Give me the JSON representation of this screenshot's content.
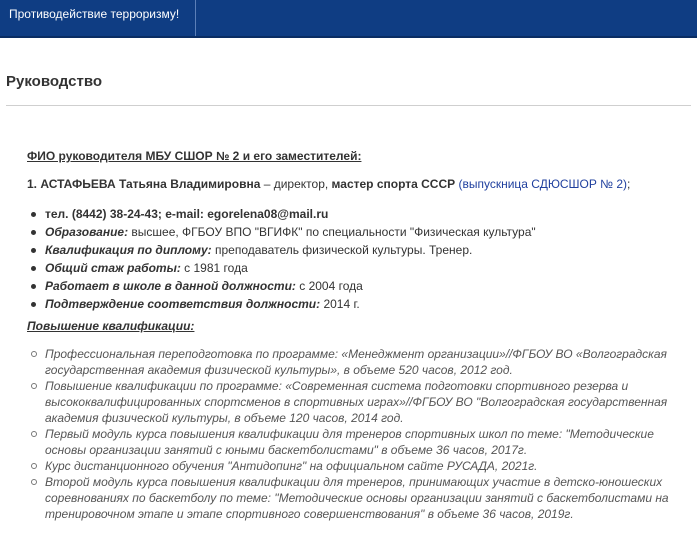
{
  "nav": {
    "item_label": "Противодействие терроризму!"
  },
  "page": {
    "title": "Руководство"
  },
  "section": {
    "heading": "ФИО руководителя МБУ СШОР № 2 и его заместителей:"
  },
  "person": {
    "number": "1.",
    "name": "АСТАФЬЕВА Татьяна Владимировна",
    "dash": " – ",
    "role": "директор, ",
    "title": "мастер спорта СССР",
    "alumna": "(выпускница СДЮСШОР № 2)",
    "end": ";"
  },
  "facts": [
    {
      "label": "тел. (8442) 38-24-43; e-mail: egorelena08@mail.ru",
      "value": ""
    },
    {
      "label": "Образование:",
      "value": " высшее, ФГБОУ ВПО \"ВГИФК\" по специальности \"Физическая культура\""
    },
    {
      "label": "Квалификация по диплому:",
      "value": " преподаватель физической культуры. Тренер."
    },
    {
      "label": "Общий стаж работы:",
      "value": " с 1981 года"
    },
    {
      "label": "Работает в школе в данной должности:",
      "value": " с 2004 года"
    },
    {
      "label": "Подтверждение соответствия должности:",
      "value": " 2014 г."
    }
  ],
  "qualification": {
    "heading": "Повышение квалификации:",
    "items": [
      "Профессиональная переподготовка по программе: «Менеджмент организации»//ФГБОУ ВО «Волгоградская государственная академия физической культуры», в объеме 520 часов, 2012 год.",
      "Повышение квалификации по программе: «Современная система подготовки спортивного резерва и высококвалифицированных спортсменов в спортивных играх»//ФГБОУ ВО \"Волгоградская государственная академия физической культуры, в объеме 120 часов, 2014 год.",
      "Первый модуль курса повышения квалификации для тренеров спортивных школ по теме: \"Методические основы организации занятий с юными баскетболистами\" в объеме 36 часов, 2017г.",
      "Курс дистанционного обучения \"Антидопинг\" на официальном сайте РУСАДА, 2021г.",
      "Второй модуль курса повышения квалификации для тренеров, принимающих участие в детско-юношеских соревнованиях по баскетболу по теме: \"Методические основы организации занятий с баскетболистами на тренировочном этапе и  этапе спортивного совершенствования\"  в объеме 36 часов, 2019г."
    ]
  }
}
